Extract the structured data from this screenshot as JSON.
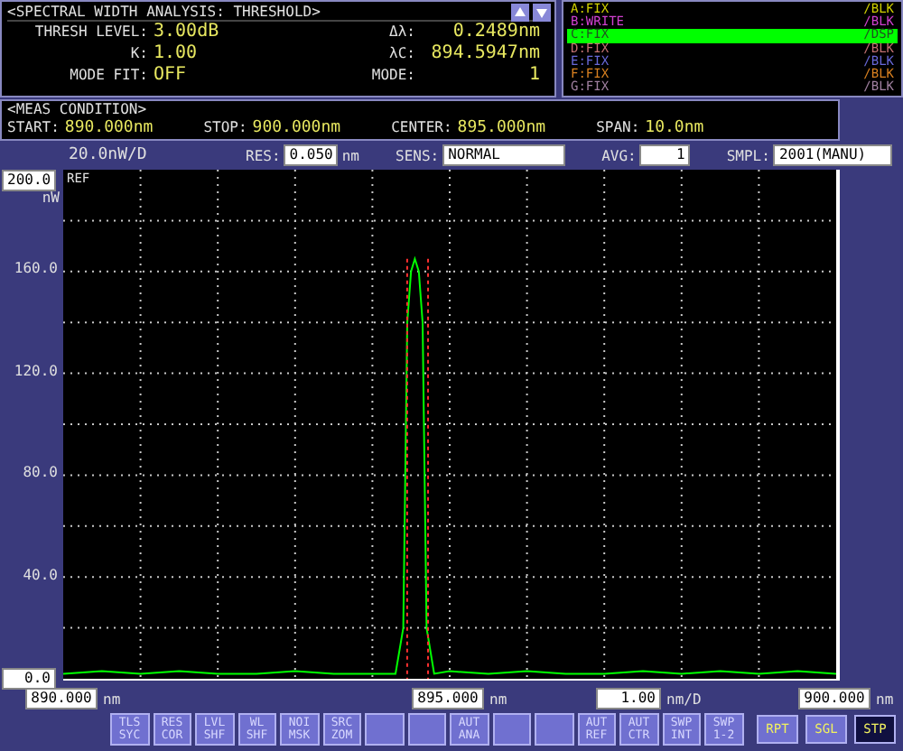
{
  "analysis": {
    "title": "<SPECTRAL WIDTH ANALYSIS: THRESHOLD>",
    "params": [
      {
        "label": "THRESH LEVEL:",
        "value": "3.00dB"
      },
      {
        "label": "K:",
        "value": "1.00"
      },
      {
        "label": "MODE FIT:",
        "value": "OFF"
      }
    ],
    "results": [
      {
        "label": "Δλ:",
        "value": "0.2489nm"
      },
      {
        "label": "λC:",
        "value": "894.5947nm"
      },
      {
        "label": "MODE:",
        "value": "1"
      }
    ]
  },
  "traces": [
    {
      "name": "A:FIX",
      "mode": "/BLK",
      "color": "#d0d000",
      "selected": false
    },
    {
      "name": "B:WRITE",
      "mode": "/BLK",
      "color": "#d040d0",
      "selected": false
    },
    {
      "name": "C:FIX",
      "mode": "/DSP",
      "color": "#00ff00",
      "selected": true
    },
    {
      "name": "D:FIX",
      "mode": "/BLK",
      "color": "#c07070",
      "selected": false
    },
    {
      "name": "E:FIX",
      "mode": "/BLK",
      "color": "#6868d8",
      "selected": false
    },
    {
      "name": "F:FIX",
      "mode": "/BLK",
      "color": "#d88020",
      "selected": false
    },
    {
      "name": "G:FIX",
      "mode": "/BLK",
      "color": "#a080a0",
      "selected": false
    }
  ],
  "meas_condition": {
    "title": "<MEAS CONDITION>",
    "items": [
      {
        "label": "START:",
        "value": "890.000nm"
      },
      {
        "label": "STOP:",
        "value": "900.000nm"
      },
      {
        "label": "CENTER:",
        "value": "895.000nm"
      },
      {
        "label": "SPAN:",
        "value": "10.0nm"
      }
    ]
  },
  "settings": {
    "scale": "20.0nW/D",
    "fields": [
      {
        "label": "RES:",
        "value": "0.050",
        "unit": "nm"
      },
      {
        "label": "SENS:",
        "value": "NORMAL"
      },
      {
        "label": "AVG:",
        "value": "1"
      },
      {
        "label": "SMPL:",
        "value": "2001(MANU)"
      }
    ]
  },
  "graph": {
    "ref_label": "REF",
    "top_value": "200.0",
    "unit": "nW",
    "bottom_value": "0.0",
    "x_units": [
      "nm",
      "nm",
      "nm"
    ],
    "x_scale": {
      "value": "1.00",
      "unit": "nm/D"
    },
    "chart_data": {
      "type": "line",
      "xlim": [
        890,
        900
      ],
      "ylim": [
        0,
        200
      ],
      "xticks": [
        {
          "value": 890,
          "label": "890.000"
        },
        {
          "value": 895,
          "label": "895.000"
        },
        {
          "value": 900,
          "label": "900.000"
        }
      ],
      "yticks": [
        {
          "value": 40,
          "label": "40.0"
        },
        {
          "value": 80,
          "label": "80.0"
        },
        {
          "value": 120,
          "label": "120.0"
        },
        {
          "value": 160,
          "label": "160.0"
        }
      ],
      "x": [
        890,
        890.5,
        891,
        891.5,
        892,
        892.5,
        893,
        893.5,
        894,
        894.3,
        894.4,
        894.45,
        894.5,
        894.55,
        894.6,
        894.65,
        894.7,
        894.8,
        895,
        895.5,
        896,
        896.5,
        897,
        897.5,
        898,
        898.5,
        899,
        899.5,
        900
      ],
      "series": [
        {
          "color": "#00ff00",
          "values": [
            2,
            3,
            2,
            3,
            2,
            2,
            3,
            2,
            2,
            2,
            20,
            140,
            160,
            165,
            160,
            140,
            20,
            2,
            3,
            2,
            3,
            2,
            2,
            3,
            2,
            3,
            2,
            3,
            2
          ]
        }
      ],
      "grid": true,
      "ref_lines": [
        {
          "axis": "x",
          "value": 894.45,
          "color": "#ff3030"
        },
        {
          "axis": "x",
          "value": 894.72,
          "color": "#ff3030"
        }
      ]
    }
  },
  "softkeys": [
    {
      "kind": "key",
      "label": "TLS SYC"
    },
    {
      "kind": "key",
      "label": "RES COR"
    },
    {
      "kind": "key",
      "label": "LVL SHF"
    },
    {
      "kind": "key",
      "label": "WL SHF"
    },
    {
      "kind": "key",
      "label": "NOI MSK"
    },
    {
      "kind": "key",
      "label": "SRC ZOM"
    },
    {
      "kind": "covered"
    },
    {
      "kind": "covered"
    },
    {
      "kind": "key",
      "label": "AUT ANA"
    },
    {
      "kind": "covered"
    },
    {
      "kind": "covered"
    },
    {
      "kind": "key",
      "label": "AUT REF"
    },
    {
      "kind": "key",
      "label": "AUT CTR"
    },
    {
      "kind": "key",
      "label": "SWP INT"
    },
    {
      "kind": "key",
      "label": "SWP 1-2"
    }
  ],
  "sweep_buttons": [
    {
      "label": "RPT",
      "selected": false
    },
    {
      "label": "SGL",
      "selected": false
    },
    {
      "label": "STP",
      "selected": true
    }
  ]
}
